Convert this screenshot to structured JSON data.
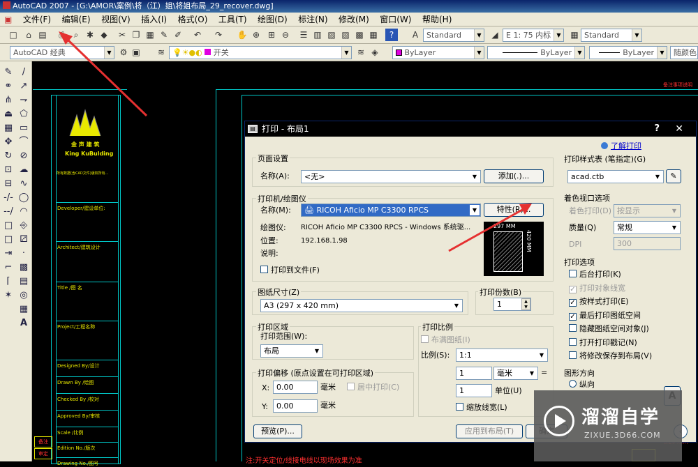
{
  "window": {
    "title": "AutoCAD 2007 - [G:\\AMOR\\案例\\将（江）姐\\将姐布局_29_recover.dwg]"
  },
  "menu": [
    "文件(F)",
    "编辑(E)",
    "视图(V)",
    "插入(I)",
    "格式(O)",
    "工具(T)",
    "绘图(D)",
    "标注(N)",
    "修改(M)",
    "窗口(W)",
    "帮助(H)"
  ],
  "toolbar1": {
    "text_style": "Standard",
    "dim_style": "E 1: 75 内标",
    "table_style": "Standard"
  },
  "toolbar2": {
    "workspace": "AutoCAD 经典",
    "layer": "开关",
    "color": "ByLayer",
    "linetype": "ByLayer",
    "lineweight": "ByLayer",
    "plotstyle": "随颜色"
  },
  "drawing": {
    "logo_name": "金 声 建 筑",
    "logo_sub": "King KuBulding",
    "notes_text": "所有数据(含CAD文件)版权所有...",
    "rows": [
      "Developer/建设单位:",
      "Architect/建筑设计",
      "Title /图    名",
      "Project/工程名称",
      "Designed By/设计",
      "Drawn By  /绘图",
      "Checked By /校对",
      "Approved By/审核",
      "Scale      /比例",
      "Edition No./版次",
      "Drawing No./图号"
    ],
    "red_labels": [
      "备注",
      "审定"
    ],
    "bottom_red_text": "注:开关定位/线接电线以现场效果为准",
    "right_red_text": "备注事项说明"
  },
  "dialog": {
    "title": "打印 - 布局1",
    "help_link": "了解打印",
    "page_setup": {
      "header": "页面设置",
      "name_label": "名称(A):",
      "name_value": "<无>",
      "add_button": "添加(.)..."
    },
    "printer": {
      "header": "打印机/绘图仪",
      "name_label": "名称(M):",
      "name_value": "RICOH Aficio MP C3300 RPCS",
      "props_button": "特性(R)...",
      "plotter_label": "绘图仪:",
      "plotter_value": "RICOH Aficio MP C3300 RPCS - Windows 系统驱...",
      "location_label": "位置:",
      "location_value": "192.168.1.98",
      "desc_label": "说明:",
      "plot_to_file": "打印到文件(F)",
      "preview_width": "297 MM",
      "preview_height": "420 MM"
    },
    "paper_size": {
      "header": "图纸尺寸(Z)",
      "value": "A3 (297 x 420 mm)"
    },
    "copies": {
      "header": "打印份数(B)",
      "value": "1"
    },
    "plot_area": {
      "header": "打印区域",
      "range_label": "打印范围(W):",
      "range_value": "布局"
    },
    "plot_offset": {
      "header": "打印偏移 (原点设置在可打印区域)",
      "x_label": "X:",
      "x_value": "0.00",
      "x_unit": "毫米",
      "y_label": "Y:",
      "y_value": "0.00",
      "y_unit": "毫米",
      "center": "居中打印(C)"
    },
    "plot_scale": {
      "header": "打印比例",
      "fit": "布满图纸(I)",
      "scale_label": "比例(S):",
      "scale_value": "1:1",
      "v1": "1",
      "unit1": "毫米",
      "v2": "1",
      "unit2": "单位(U)",
      "scale_lw": "缩放线宽(L)"
    },
    "plot_style_table": {
      "header": "打印样式表 (笔指定)(G)",
      "value": "acad.ctb"
    },
    "shaded": {
      "header": "着色视口选项",
      "shade_label": "着色打印(D)",
      "shade_value": "按显示",
      "quality_label": "质量(Q)",
      "quality_value": "常规",
      "dpi_label": "DPI",
      "dpi_value": "300"
    },
    "plot_options": {
      "header": "打印选项",
      "items": [
        {
          "label": "后台打印(K)",
          "checked": false,
          "disabled": false
        },
        {
          "label": "打印对象线宽",
          "checked": true,
          "disabled": true
        },
        {
          "label": "按样式打印(E)",
          "checked": true,
          "disabled": false
        },
        {
          "label": "最后打印图纸空间",
          "checked": true,
          "disabled": false
        },
        {
          "label": "隐藏图纸空间对象(J)",
          "checked": false,
          "disabled": false
        },
        {
          "label": "打开打印戳记(N)",
          "checked": false,
          "disabled": false
        },
        {
          "label": "将修改保存到布局(V)",
          "checked": false,
          "disabled": false
        }
      ]
    },
    "orientation": {
      "header": "图形方向",
      "portrait": "纵向",
      "preview_glyph": "A"
    },
    "buttons": {
      "preview": "预览(P)...",
      "apply": "应用到布局(T)",
      "ok": "确定"
    }
  },
  "watermark": {
    "brand": "溜溜自学",
    "url": "ZIXUE.3D66.COM"
  },
  "colors": {
    "title_blue": "#0a246a",
    "dialog_bg": "#ece9d8",
    "cyan": "#00c8c8",
    "arrow": "#e53030",
    "selection": "#316ac5"
  }
}
